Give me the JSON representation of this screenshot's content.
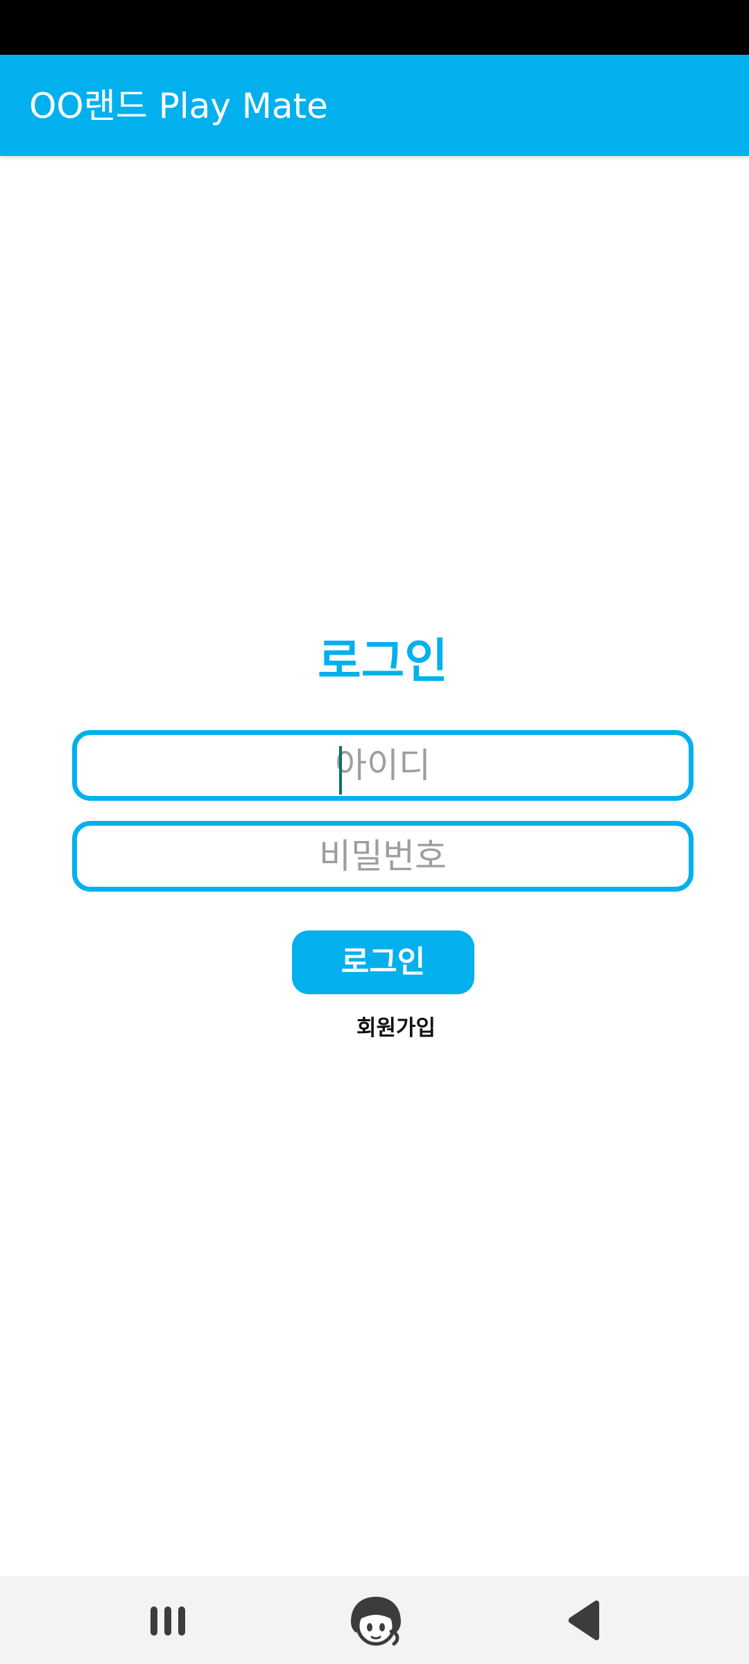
{
  "app_bar": {
    "title": "OO랜드 Play Mate",
    "color": "#03b0ee"
  },
  "login_form": {
    "heading": "로그인",
    "id_field": {
      "placeholder": "아이디",
      "value": ""
    },
    "password_field": {
      "placeholder": "비밀번호",
      "value": ""
    },
    "login_button_label": "로그인",
    "signup_link_label": "회원가입"
  },
  "navigation_bar": {
    "recent_apps_icon": "recent-apps-icon",
    "home_icon": "character-face-home-icon",
    "back_icon": "back-triangle-icon"
  }
}
